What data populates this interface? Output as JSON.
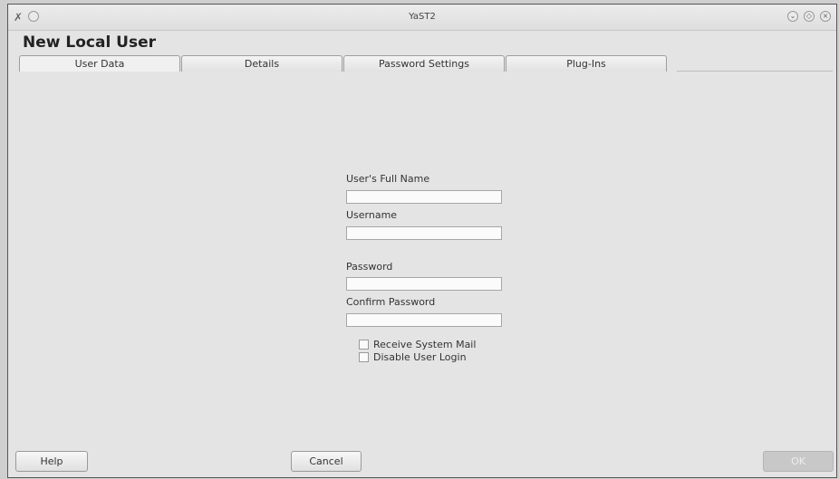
{
  "window": {
    "title": "YaST2",
    "app_icon": "yast-icon",
    "controls": [
      "minimize-icon",
      "maximize-icon",
      "close-icon"
    ]
  },
  "dialog": {
    "title": "New Local User"
  },
  "tabs": [
    {
      "label": "User Data",
      "active": true
    },
    {
      "label": "Details",
      "active": false
    },
    {
      "label": "Password Settings",
      "active": false
    },
    {
      "label": "Plug-Ins",
      "active": false
    }
  ],
  "form": {
    "full_name": {
      "label": "User's Full Name",
      "value": ""
    },
    "username": {
      "label": "Username",
      "value": ""
    },
    "password": {
      "label": "Password",
      "value": ""
    },
    "confirm_password": {
      "label": "Confirm Password",
      "value": ""
    },
    "receive_mail": {
      "label": "Receive System Mail",
      "checked": false
    },
    "disable_login": {
      "label": "Disable User Login",
      "checked": false
    }
  },
  "buttons": {
    "help": "Help",
    "cancel": "Cancel",
    "ok": "OK"
  }
}
